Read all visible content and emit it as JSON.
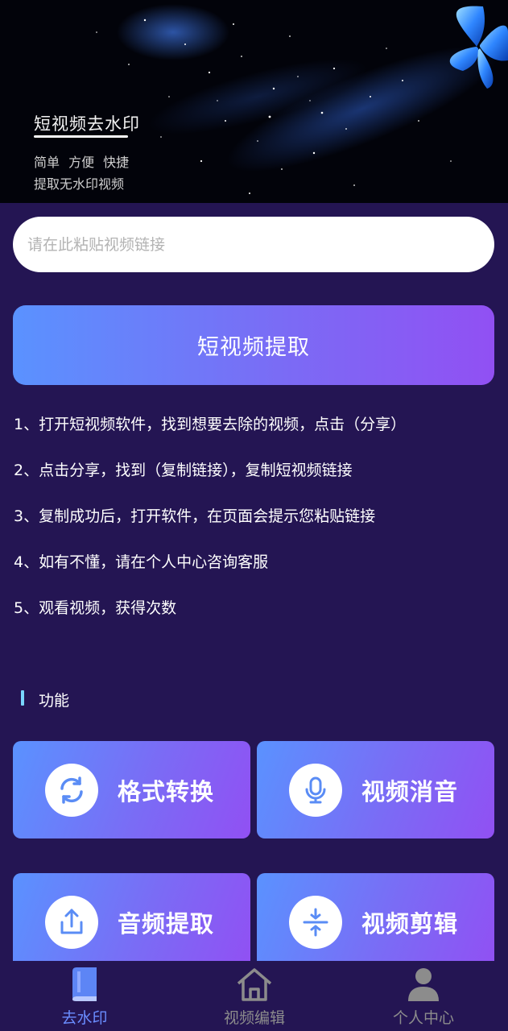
{
  "banner": {
    "title": "短视频去水印",
    "subtitle1": "简单 方便 快捷",
    "subtitle2": "提取无水印视频"
  },
  "search": {
    "placeholder": "请在此粘贴视频链接",
    "value": ""
  },
  "extract_button": {
    "label": "短视频提取"
  },
  "steps": [
    "1、打开短视频软件，找到想要去除的视频，点击（分享）",
    "2、点击分享，找到（复制链接），复制短视频链接",
    "3、复制成功后，打开软件，在页面会提示您粘贴链接",
    "4、如有不懂，请在个人中心咨询客服",
    "5、观看视频，获得次数"
  ],
  "section": {
    "title": "功能"
  },
  "features": [
    {
      "label": "格式转换",
      "icon": "refresh-icon"
    },
    {
      "label": "视频消音",
      "icon": "microphone-icon"
    },
    {
      "label": "音频提取",
      "icon": "upload-icon"
    },
    {
      "label": "视频剪辑",
      "icon": "compress-icon"
    }
  ],
  "nav": [
    {
      "label": "去水印",
      "icon": "book-icon",
      "active": true
    },
    {
      "label": "视频编辑",
      "icon": "home-icon",
      "active": false
    },
    {
      "label": "个人中心",
      "icon": "person-icon",
      "active": false
    }
  ],
  "colors": {
    "background": "#241553",
    "accent_start": "#5a92ff",
    "accent_end": "#9150f3",
    "nav_active": "#6a8dff",
    "nav_inactive": "#8c8c8c"
  }
}
